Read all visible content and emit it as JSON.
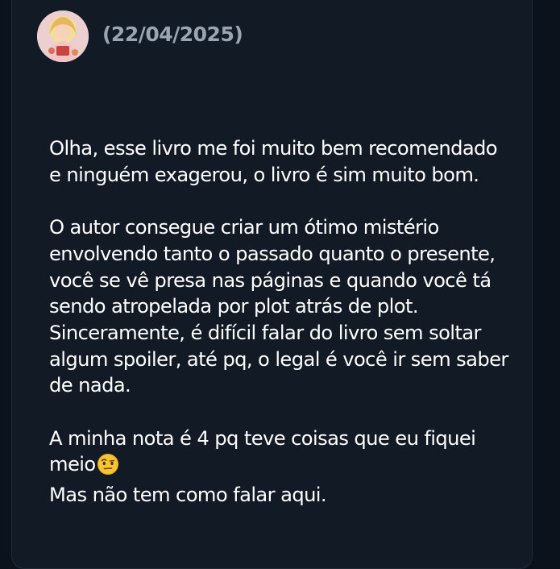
{
  "review": {
    "date": "(22/04/2025)",
    "paragraphs": [
      "Olha, esse livro me foi muito bem recomendado e ninguém exagerou, o livro é sim muito bom.",
      "O autor consegue criar um ótimo mistério envolvendo tanto o passado quanto o presente, você se vê presa nas páginas e quando você tá sendo atropelada por plot atrás de plot. Sinceramente, é difícil falar do livro sem soltar algum spoiler, até pq, o legal é você ir sem saber de nada."
    ],
    "closing_line_1": "A minha nota é 4 pq teve coisas que eu fiquei meio",
    "closing_emoji": "face-with-raised-eyebrow-emoji",
    "closing_line_2": "Mas não tem como falar aqui."
  },
  "colors": {
    "background": "#0c121b",
    "card": "#121a25",
    "text": "#ffffff",
    "date_text": "#9aa5b4"
  }
}
